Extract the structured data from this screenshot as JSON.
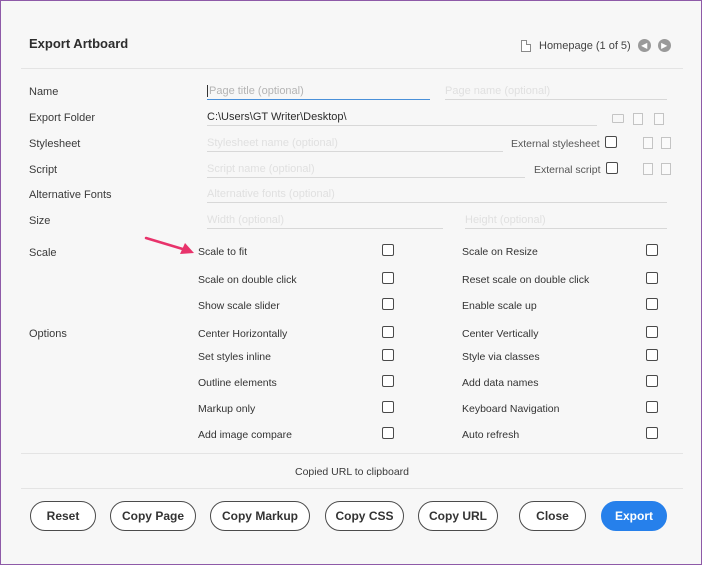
{
  "header": {
    "title": "Export Artboard",
    "nav_label": "Homepage (1 of 5)"
  },
  "form": {
    "name": {
      "label": "Name",
      "title_placeholder": "Page title (optional)",
      "page_placeholder": "Page name (optional)"
    },
    "folder": {
      "label": "Export Folder",
      "value": "C:\\Users\\GT Writer\\Desktop\\"
    },
    "stylesheet": {
      "label": "Stylesheet",
      "placeholder": "Stylesheet name (optional)",
      "external_label": "External stylesheet"
    },
    "script": {
      "label": "Script",
      "placeholder": "Script name (optional)",
      "external_label": "External script"
    },
    "fonts": {
      "label": "Alternative Fonts",
      "placeholder": "Alternative fonts (optional)"
    },
    "size": {
      "label": "Size",
      "width_placeholder": "Width (optional)",
      "height_placeholder": "Height (optional)"
    }
  },
  "scale": {
    "label": "Scale",
    "left": [
      "Scale to fit",
      "Scale on double click",
      "Show scale slider"
    ],
    "right": [
      "Scale on Resize",
      "Reset scale on double click",
      "Enable scale up"
    ]
  },
  "options": {
    "label": "Options",
    "left": [
      "Center Horizontally",
      "Set styles inline",
      "Outline elements",
      "Markup only",
      "Add image compare"
    ],
    "right": [
      "Center Vertically",
      "Style via classes",
      "Add data names",
      "Keyboard Navigation",
      "Auto refresh"
    ]
  },
  "status_text": "Copied URL to clipboard",
  "buttons": {
    "reset": "Reset",
    "copy_page": "Copy Page",
    "copy_markup": "Copy Markup",
    "copy_css": "Copy CSS",
    "copy_url": "Copy URL",
    "close": "Close",
    "export": "Export"
  },
  "colors": {
    "accent": "#2680eb",
    "annotation_arrow": "#e8336b",
    "focus_underline": "#4a90d9"
  }
}
